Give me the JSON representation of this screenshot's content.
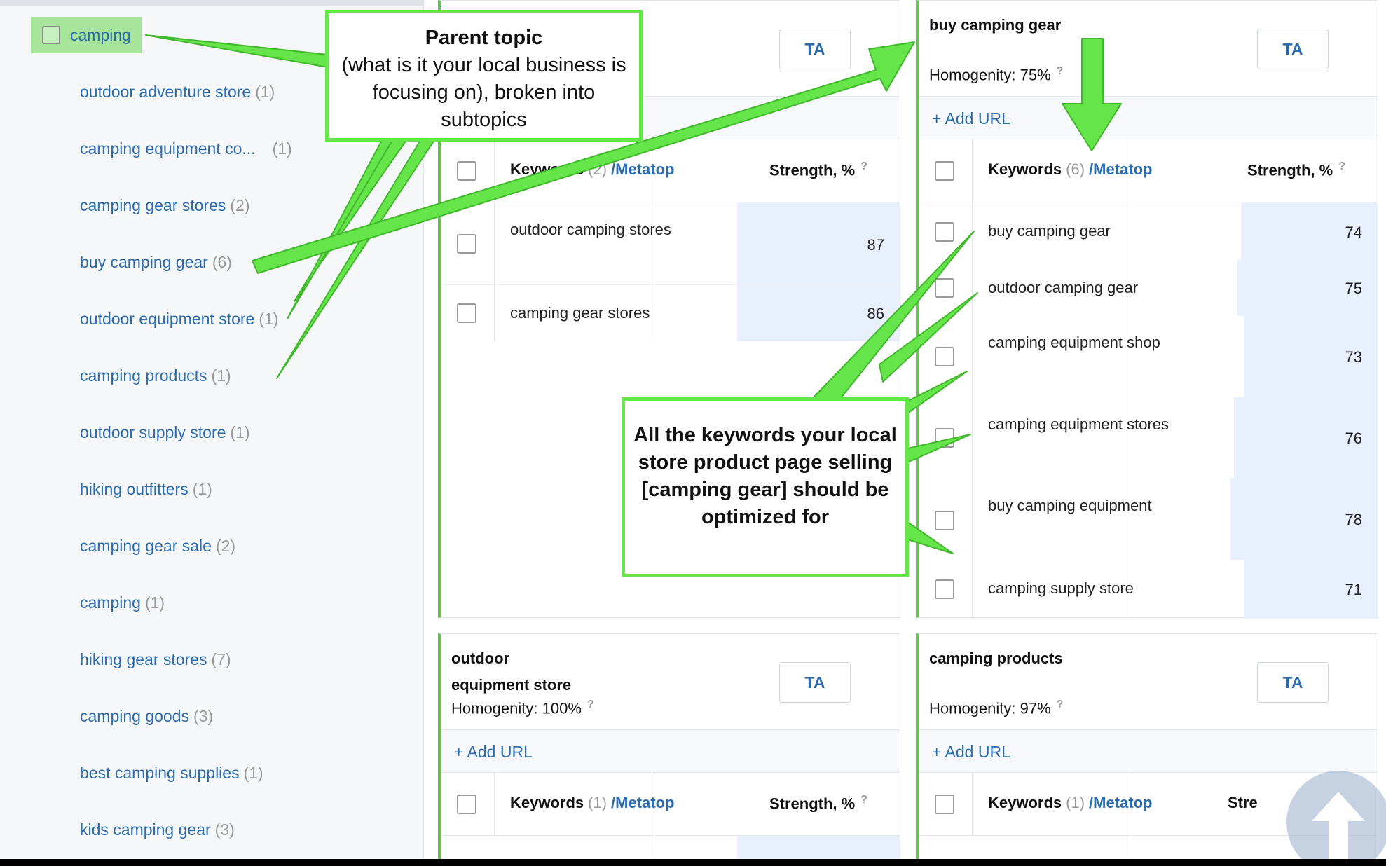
{
  "sidebar": {
    "parent": {
      "label": "camping"
    },
    "items": [
      {
        "label": "outdoor adventure store",
        "count": "(1)"
      },
      {
        "label": "camping equipment co...",
        "count": "(1)"
      },
      {
        "label": "camping gear stores",
        "count": "(2)"
      },
      {
        "label": "buy camping gear",
        "count": "(6)"
      },
      {
        "label": "outdoor equipment store",
        "count": "(1)"
      },
      {
        "label": "camping products",
        "count": "(1)"
      },
      {
        "label": "outdoor supply store",
        "count": "(1)"
      },
      {
        "label": "hiking outfitters",
        "count": "(1)"
      },
      {
        "label": "camping gear sale",
        "count": "(2)"
      },
      {
        "label": "camping",
        "count": "(1)"
      },
      {
        "label": "hiking gear stores",
        "count": "(7)"
      },
      {
        "label": "camping goods",
        "count": "(3)"
      },
      {
        "label": "best camping supplies",
        "count": "(1)"
      },
      {
        "label": "kids camping gear",
        "count": "(3)"
      }
    ]
  },
  "cards": [
    {
      "ta": "TA",
      "kw_header": {
        "label": "Keywords",
        "count": "(2)",
        "meta": "/Metatop"
      },
      "strength_header": "Strength, %",
      "help": "?",
      "rows": [
        {
          "keyword": "outdoor camping stores",
          "strength": 87
        },
        {
          "keyword": "camping gear stores",
          "strength": 86
        }
      ]
    },
    {
      "title": "buy camping gear",
      "homogeneity": "Homogenity: 75%",
      "ta": "TA",
      "add_url": "+ Add URL",
      "kw_header": {
        "label": "Keywords",
        "count": "(6)",
        "meta": "/Metatop"
      },
      "strength_header": "Strength, %",
      "help": "?",
      "rows": [
        {
          "keyword": "buy camping gear",
          "strength": 74
        },
        {
          "keyword": "outdoor camping gear",
          "strength": 75
        },
        {
          "keyword": "camping equipment shop",
          "strength": 73
        },
        {
          "keyword": "camping equipment stores",
          "strength": 76
        },
        {
          "keyword": "buy camping equipment",
          "strength": 78
        },
        {
          "keyword": "camping supply store",
          "strength": 71
        }
      ]
    },
    {
      "title": "outdoor equipment store",
      "homogeneity": "Homogenity: 100%",
      "ta": "TA",
      "add_url": "+ Add URL",
      "kw_header": {
        "label": "Keywords",
        "count": "(1)",
        "meta": "/Metatop"
      },
      "strength_header": "Strength, %",
      "help": "?"
    },
    {
      "title": "camping products",
      "homogeneity": "Homogenity: 97%",
      "ta": "TA",
      "add_url": "+ Add URL",
      "kw_header": {
        "label": "Keywords",
        "count": "(1)",
        "meta": "/Metatop"
      },
      "strength_header": "Stre"
    }
  ],
  "annotations": {
    "parent_topic": {
      "title": "Parent topic",
      "body": "(what is it your local business is focusing on), broken into subtopics"
    },
    "keywords_note": "All the keywords your local store product page selling [camping gear] should be optimized for"
  },
  "colors": {
    "accent_green": "#65e54a",
    "card_border_green": "#6bbf59",
    "link_blue": "#2b6cb0",
    "strength_fill": "#e8effd",
    "sidebar_bg": "#f6f7f9"
  },
  "icons": {
    "scroll_top": "arrow-up-icon",
    "help": "question-mark-icon"
  }
}
